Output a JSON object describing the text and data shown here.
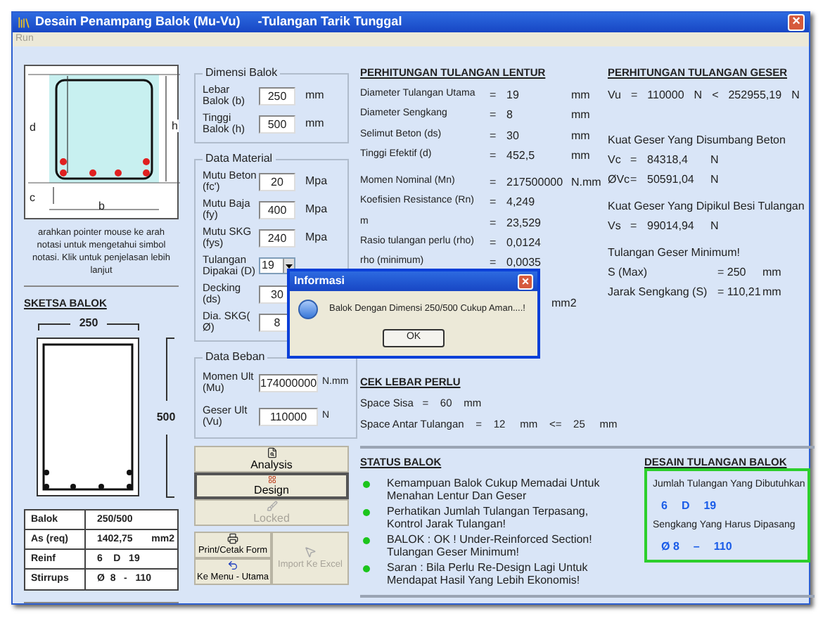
{
  "window": {
    "title": "Desain Penampang Balok (Mu-Vu)     -Tulangan Tarik Tunggal",
    "close": "×"
  },
  "menu": [
    {
      "label": "Run",
      "disabled": true
    }
  ],
  "diagram": {
    "labels": [
      "d",
      "h",
      "c",
      "b"
    ],
    "hint": "arahkan pointer mouse ke arah notasi untuk mengetahui simbol notasi. Klik untuk penjelasan lebih lanjut"
  },
  "sketch": {
    "title": "SKETSA BALOK",
    "width_label": "250",
    "height_label": "500"
  },
  "summary": [
    {
      "label": "Balok",
      "value": "250/500"
    },
    {
      "label": "As (req)",
      "value": "1402,75",
      "unit": "mm2"
    },
    {
      "label": "Reinf",
      "value": "6    D   19"
    },
    {
      "label": "Stirrups",
      "value": "Ø  8   -   110"
    }
  ],
  "groups": [
    {
      "title": "Dimensi Balok",
      "fields": [
        {
          "kind": "input",
          "label": "Lebar Balok (b)",
          "value": "250",
          "unit": "mm"
        },
        {
          "kind": "input",
          "label": "Tinggi Balok (h)",
          "value": "500",
          "unit": "mm"
        }
      ]
    },
    {
      "title": "Data Material",
      "fields": [
        {
          "kind": "input",
          "label": "Mutu Beton (fc')",
          "value": "20",
          "unit": "Mpa"
        },
        {
          "kind": "input",
          "label": "Mutu Baja (fy)",
          "value": "400",
          "unit": "Mpa"
        },
        {
          "kind": "input",
          "label": "Mutu SKG (fys)",
          "value": "240",
          "unit": "Mpa"
        },
        {
          "kind": "dropdown",
          "label": "Tulangan Dipakai (D)",
          "value": "19"
        },
        {
          "kind": "input",
          "label": "Decking (ds)",
          "value": "30"
        },
        {
          "kind": "input",
          "label": "Dia. SKG( Ø)",
          "value": "8"
        }
      ]
    },
    {
      "title": "Data Beban",
      "fields": [
        {
          "kind": "wide",
          "label": "Momen Ult (Mu)",
          "value": "174000000",
          "unit": "N.mm"
        },
        {
          "kind": "wide",
          "label": "Geser Ult (Vu)",
          "value": "110000",
          "unit": "N"
        }
      ]
    }
  ],
  "buttons": [
    {
      "kind": "analysis",
      "label": "Analysis",
      "disabled": false,
      "focused": false
    },
    {
      "kind": "design",
      "label": "Design",
      "disabled": false,
      "focused": true
    },
    {
      "kind": "locked",
      "label": "Locked",
      "disabled": true,
      "focused": false
    }
  ],
  "buttons_bottom": [
    {
      "kind": "print",
      "label": "Print/Cetak Form",
      "disabled": false
    },
    {
      "kind": "menu",
      "label": "Ke Menu - Utama",
      "disabled": false
    },
    {
      "kind": "import",
      "label": "Import Ke Excel",
      "disabled": true
    }
  ],
  "lentur": {
    "title": "PERHITUNGAN TULANGAN LENTUR",
    "rows": [
      {
        "label": "Diameter Tulangan Utama",
        "eq": "=",
        "value": "19",
        "unit": "mm"
      },
      {
        "label": "Diameter Sengkang",
        "eq": "=",
        "value": "8",
        "unit": "mm"
      },
      {
        "label": "Selimut Beton (ds)",
        "eq": "=",
        "value": "30",
        "unit": "mm"
      },
      {
        "label": "Tinggi Efektif (d)",
        "eq": "=",
        "value": "452,5",
        "unit": "mm"
      },
      {
        "label": "Momen Nominal (Mn)",
        "eq": "=",
        "value": "217500000",
        "unit": "N.mm"
      },
      {
        "label": "Koefisien Resistance (Rn)",
        "eq": "=",
        "value": "4,249"
      },
      {
        "label": "m",
        "eq": "=",
        "value": "23,529"
      },
      {
        "label": "Rasio tulangan perlu (rho)",
        "eq": "=",
        "value": "0,0124"
      },
      {
        "label": "rho (minimum)",
        "eq": "=",
        "value": "0,0035"
      }
    ],
    "covered_unit": "mm2"
  },
  "cek": {
    "title": "CEK LEBAR PERLU",
    "rows": [
      "Space Sisa   =    60    mm",
      "Space Antar Tulangan    =    12     mm    <=    25     mm"
    ]
  },
  "geser": {
    "title": "PERHITUNGAN TULANGAN GESER",
    "vu": [
      "Vu",
      "=",
      "110000",
      "N",
      "<",
      "252955,19",
      "N"
    ],
    "sections": [
      {
        "heading": "Kuat Geser Yang Disumbang Beton",
        "rows": [
          [
            "Vc",
            "=",
            "84318,4",
            "N"
          ],
          [
            "ØVc",
            "=",
            "50591,04",
            "N"
          ]
        ]
      },
      {
        "heading": "Kuat Geser Yang Dipikul Besi Tulangan",
        "rows": [
          [
            "Vs",
            "=",
            "99014,94",
            "N"
          ]
        ]
      },
      {
        "heading": "Tulangan Geser Minimum!",
        "rows": [
          [
            "S (Max)",
            "= 250",
            "mm"
          ],
          [
            "Jarak Sengkang (S)",
            "= 110,21",
            "mm"
          ]
        ]
      }
    ]
  },
  "status": {
    "title": "STATUS BALOK",
    "items": [
      {
        "color": "#1cc51c",
        "lines": [
          "Kemampuan Balok Cukup Memadai Untuk Menahan Lentur Dan Geser"
        ]
      },
      {
        "color": "#1cc51c",
        "lines": [
          "Perhatikan Jumlah Tulangan Terpasang, Kontrol Jarak Tulangan!"
        ]
      },
      {
        "color": "#1cc51c",
        "lines": [
          "BALOK : OK !  Under-Reinforced Section!",
          "Tulangan Geser Minimum!"
        ]
      },
      {
        "color": "#1cc51c",
        "lines": [
          "Saran : Bila Perlu Re-Design Lagi Untuk Mendapat Hasil Yang Lebih Ekonomis!"
        ]
      }
    ]
  },
  "desain": {
    "title": "DESAIN TULANGAN BALOK",
    "rows": [
      {
        "label": "Jumlah Tulangan Yang Dibutuhkan",
        "values": [
          "6",
          "D",
          "19"
        ]
      },
      {
        "label": "Sengkang Yang Harus Dipasang",
        "values": [
          "Ø 8",
          "–",
          "110"
        ]
      }
    ]
  },
  "dialog": {
    "title": "Informasi",
    "message": "Balok Dengan Dimensi 250/500 Cukup Aman....!",
    "button": "OK",
    "close": "×"
  }
}
